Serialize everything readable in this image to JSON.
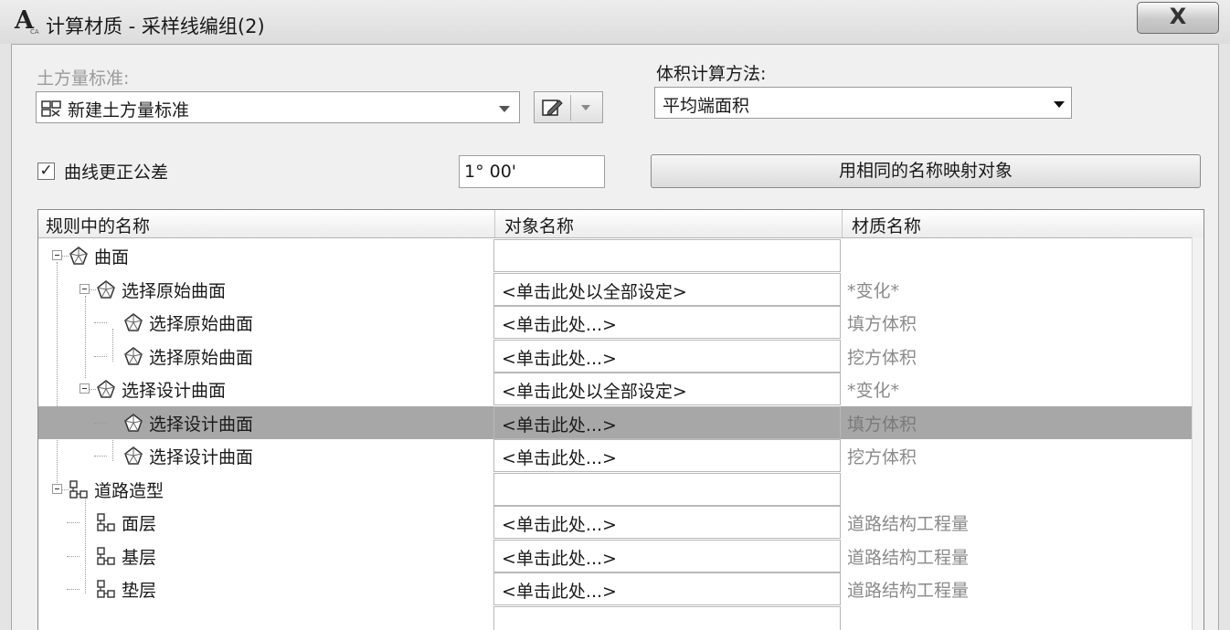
{
  "window": {
    "title": "计算材质 - 采样线编组(2)",
    "close_label": "X",
    "app_icon_letter": "A",
    "app_icon_sub": "CA"
  },
  "quantity_criteria": {
    "label": "土方量标准:",
    "value": "新建土方量标准"
  },
  "volume_method": {
    "label": "体积计算方法:",
    "value": "平均端面积"
  },
  "curve_correction": {
    "label": "曲线更正公差",
    "checked": true,
    "value": "1° 00'"
  },
  "map_button_label": "用相同的名称映射对象",
  "table": {
    "headers": [
      "规则中的名称",
      "对象名称",
      "材质名称"
    ],
    "rows": [
      {
        "name": "曲面",
        "object": "",
        "material": "",
        "icon": "surface-icon"
      },
      {
        "name": "选择原始曲面",
        "object": "<单击此处以全部设定>",
        "material": "*变化*",
        "icon": "surface-icon"
      },
      {
        "name": "选择原始曲面",
        "object": "<单击此处...>",
        "material": "填方体积",
        "icon": "surface-icon"
      },
      {
        "name": "选择原始曲面",
        "object": "<单击此处...>",
        "material": "挖方体积",
        "icon": "surface-icon"
      },
      {
        "name": "选择设计曲面",
        "object": "<单击此处以全部设定>",
        "material": "*变化*",
        "icon": "surface-icon"
      },
      {
        "name": "选择设计曲面",
        "object": "<单击此处...>",
        "material": "填方体积",
        "icon": "surface-icon",
        "selected": true
      },
      {
        "name": "选择设计曲面",
        "object": "<单击此处...>",
        "material": "挖方体积",
        "icon": "surface-icon"
      },
      {
        "name": "道路造型",
        "object": "",
        "material": "",
        "icon": "corridor-icon"
      },
      {
        "name": "面层",
        "object": "<单击此处...>",
        "material": "道路结构工程量",
        "icon": "corridor-icon"
      },
      {
        "name": "基层",
        "object": "<单击此处...>",
        "material": "道路结构工程量",
        "icon": "corridor-icon"
      },
      {
        "name": "垫层",
        "object": "<单击此处...>",
        "material": "道路结构工程量",
        "icon": "corridor-icon"
      }
    ]
  }
}
